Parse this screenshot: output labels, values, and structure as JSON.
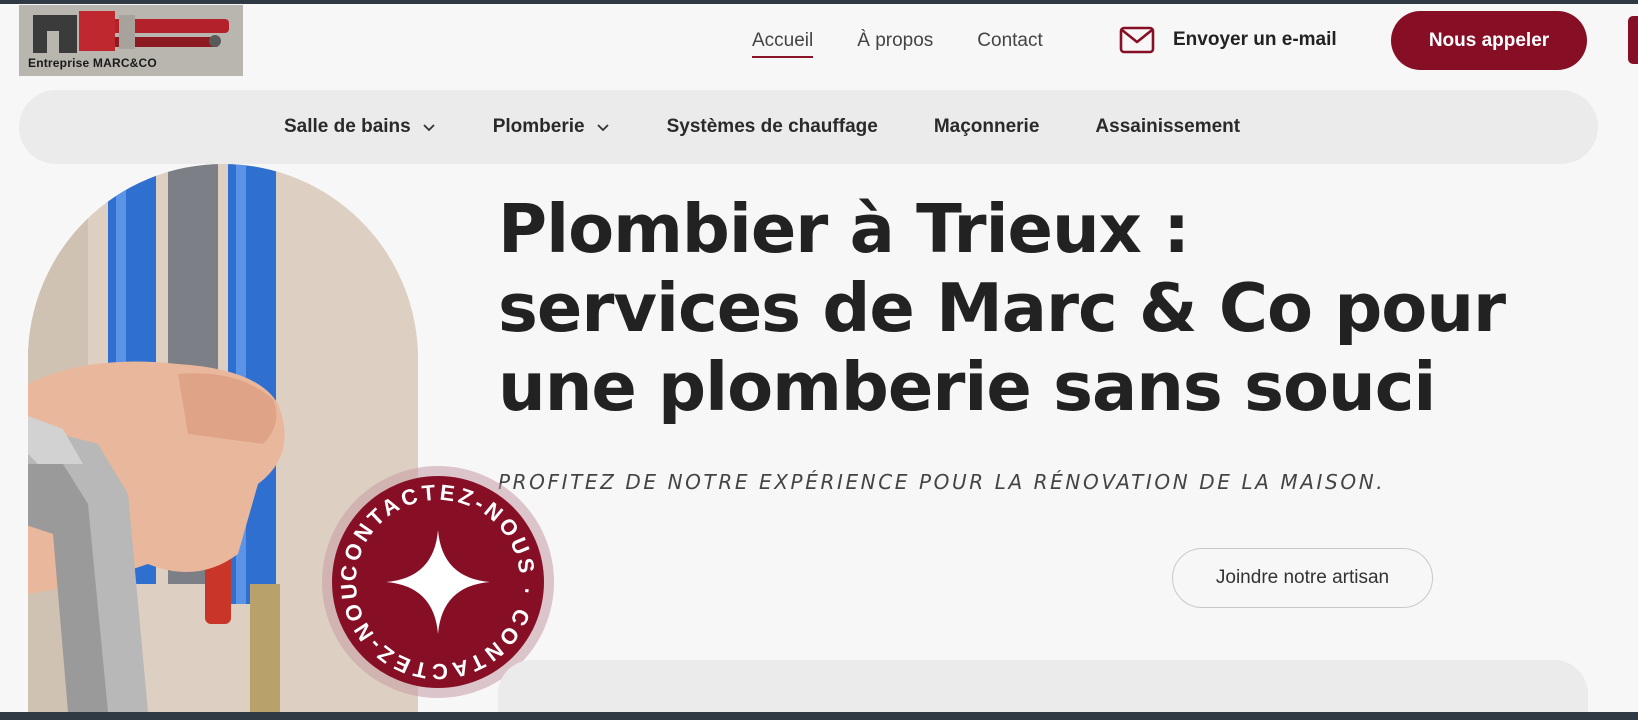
{
  "header": {
    "logo_text": "Entreprise MARC&CO",
    "nav": [
      {
        "label": "Accueil",
        "active": true
      },
      {
        "label": "À propos",
        "active": false
      },
      {
        "label": "Contact",
        "active": false
      }
    ],
    "email_label": "Envoyer un e-mail",
    "call_button": "Nous appeler",
    "icons": {
      "email": "envelope-icon"
    }
  },
  "menu": {
    "items": [
      {
        "label": "Salle de bains",
        "has_dropdown": true
      },
      {
        "label": "Plomberie",
        "has_dropdown": true
      },
      {
        "label": "Systèmes de chauffage",
        "has_dropdown": false
      },
      {
        "label": "Maçonnerie",
        "has_dropdown": false
      },
      {
        "label": "Assainissement",
        "has_dropdown": false
      }
    ]
  },
  "hero": {
    "title": "Plombier à Trieux : services de Marc & Co pour une plomberie sans souci",
    "subtitle": "PROFITEZ DE NOTRE EXPÉRIENCE POUR LA RÉNOVATION DE LA MAISON.",
    "cta_label": "Joindre notre artisan",
    "badge_text": "CONTACTEZ-NOUS · CONTACTEZ-NOUS · "
  },
  "colors": {
    "brand": "#860f26",
    "background": "#f7f7f7",
    "menu_bg": "#ebebeb",
    "text": "#222222"
  }
}
